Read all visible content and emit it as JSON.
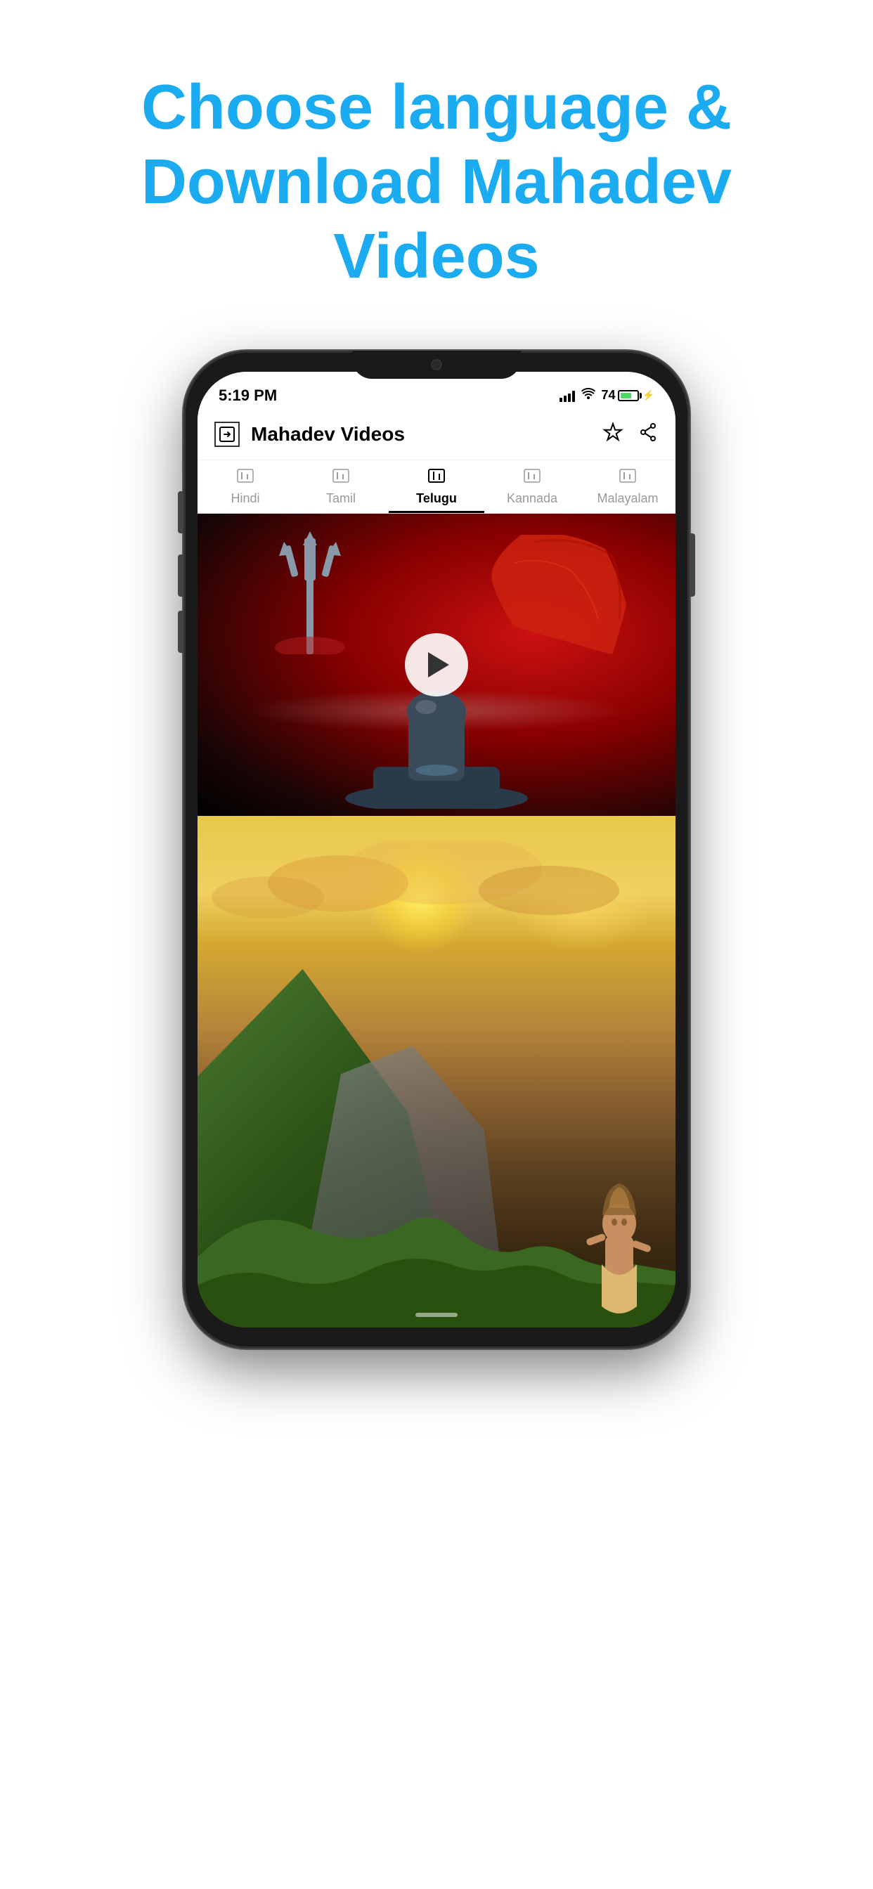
{
  "header": {
    "line1": "Choose language &",
    "line2": "Download Mahadev",
    "line3": "Videos",
    "color": "#1AABF0"
  },
  "status_bar": {
    "time": "5:19 PM",
    "battery_percent": "74",
    "battery_color": "#4CD964"
  },
  "app_bar": {
    "title": "Mahadev Videos"
  },
  "tabs": [
    {
      "id": "hindi",
      "label": "Hindi",
      "active": false
    },
    {
      "id": "tamil",
      "label": "Tamil",
      "active": false
    },
    {
      "id": "telugu",
      "label": "Telugu",
      "active": true
    },
    {
      "id": "kannada",
      "label": "Kannada",
      "active": false
    },
    {
      "id": "malayalam",
      "label": "Malayalam",
      "active": false
    }
  ],
  "videos": [
    {
      "id": "video1",
      "type": "shivling",
      "description": "Shivling with Trishul animation"
    },
    {
      "id": "video2",
      "type": "shiva-mountain",
      "description": "Shiva on mountain landscape"
    }
  ]
}
